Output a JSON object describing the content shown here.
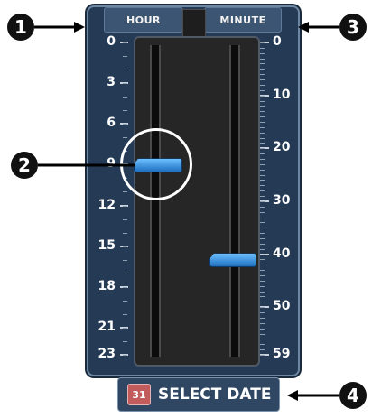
{
  "header": {
    "hour_label": "HOUR",
    "minute_label": "MINUTE"
  },
  "hour_scale": {
    "ticks": [
      "0",
      "3",
      "6",
      "9",
      "12",
      "15",
      "18",
      "21",
      "23"
    ],
    "max": 23,
    "value": 9
  },
  "minute_scale": {
    "ticks": [
      "0",
      "10",
      "20",
      "30",
      "40",
      "50",
      "59"
    ],
    "max": 59,
    "value": 41
  },
  "select_date": {
    "label": "SELECT DATE",
    "icon_text": "31"
  },
  "callouts": [
    "1",
    "2",
    "3",
    "4"
  ],
  "colors": {
    "panel": "#243a55",
    "track": "#262626",
    "thumb": "#2f8fe0",
    "callout_circle": "#ffffff"
  }
}
